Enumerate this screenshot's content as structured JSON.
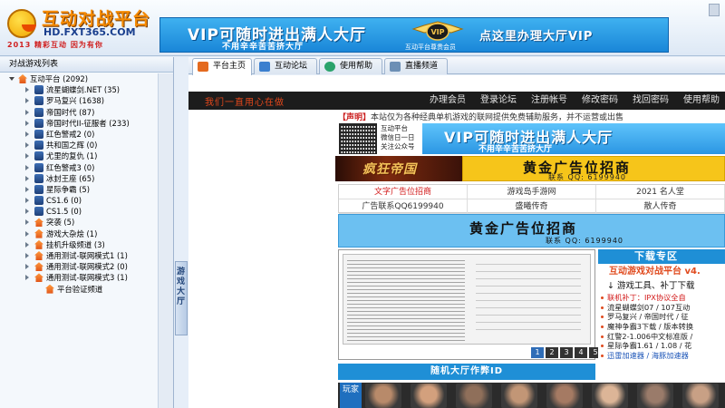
{
  "header": {
    "logo_title": "互动对战平台",
    "logo_domain": "HD.FXT365.COM",
    "logo_slogan": "2013 精彩互动 因为有你",
    "banner_main": "VIP可随时进出满人大厅",
    "banner_sub": "不用辛辛苦苦挤大厅",
    "banner_vip_caption": "互动平台尊贵会员",
    "banner_cta": "点这里办理大厅VIP"
  },
  "left_panel": {
    "title": "对战游戏列表",
    "tree": [
      {
        "label": "互动平台 (2092)",
        "level": 0,
        "expanded": true,
        "icon": "house-icon"
      },
      {
        "label": "流星蝴蝶剑.NET (35)",
        "level": 1,
        "icon": "game-icon"
      },
      {
        "label": "罗马复兴 (1638)",
        "level": 1,
        "icon": "game-icon"
      },
      {
        "label": "帝国时代 (87)",
        "level": 1,
        "icon": "game-icon"
      },
      {
        "label": "帝国时代II-征服者 (233)",
        "level": 1,
        "icon": "game-icon"
      },
      {
        "label": "红色警戒2 (0)",
        "level": 1,
        "icon": "game-icon"
      },
      {
        "label": "共和国之辉 (0)",
        "level": 1,
        "icon": "game-icon"
      },
      {
        "label": "尤里的复仇 (1)",
        "level": 1,
        "icon": "game-icon"
      },
      {
        "label": "红色警戒3 (0)",
        "level": 1,
        "icon": "game-icon"
      },
      {
        "label": "冰封王座 (65)",
        "level": 1,
        "icon": "game-icon"
      },
      {
        "label": "星际争霸 (5)",
        "level": 1,
        "icon": "game-icon"
      },
      {
        "label": "CS1.6 (0)",
        "level": 1,
        "icon": "game-icon"
      },
      {
        "label": "CS1.5 (0)",
        "level": 1,
        "icon": "game-icon"
      },
      {
        "label": "突袭 (5)",
        "level": 1,
        "icon": "house-icon"
      },
      {
        "label": "游戏大杂烩 (1)",
        "level": 1,
        "icon": "house-icon"
      },
      {
        "label": "挂机升级频道 (3)",
        "level": 1,
        "icon": "house-icon"
      },
      {
        "label": "通用测试-联网模式1 (1)",
        "level": 1,
        "icon": "house-icon"
      },
      {
        "label": "通用测试-联网模式2 (0)",
        "level": 1,
        "icon": "house-icon"
      },
      {
        "label": "通用测试-联网模式3 (1)",
        "level": 1,
        "icon": "house-icon"
      },
      {
        "label": "平台验证频道",
        "level": 2,
        "icon": "house-icon"
      }
    ],
    "collapse_tab": "游戏大厅"
  },
  "tabs": [
    {
      "label": "平台主页",
      "active": true,
      "icon": "home-icon"
    },
    {
      "label": "互动论坛",
      "active": false,
      "icon": "forum-icon"
    },
    {
      "label": "使用帮助",
      "active": false,
      "icon": "help-icon"
    },
    {
      "label": "直播频道",
      "active": false,
      "icon": "live-icon"
    }
  ],
  "navbar": {
    "slogan": "我们一直用心在做",
    "links": [
      "办理会员",
      "登录论坛",
      "注册帐号",
      "修改密码",
      "找回密码",
      "使用帮助"
    ]
  },
  "notice": {
    "tag": "【声明】",
    "text": "本站仅为各种经典单机游戏的联网提供免费辅助服务，并不运营或出售"
  },
  "qr": {
    "line1": "互动平台",
    "line2": "微信日一日",
    "line3": "关注公众号"
  },
  "vip_banner": {
    "main": "VIP可随时进出满人大厅",
    "sub": "不用辛辛苦苦挤大厅"
  },
  "game_ad": {
    "title": "疯狂帝国"
  },
  "gold_ad": {
    "title": "黄金广告位招商",
    "contact": "联系 QQ: 6199940"
  },
  "link_grid": [
    {
      "label": "文字广告位招商",
      "red": true
    },
    {
      "label": "游戏岛手游网",
      "red": false
    },
    {
      "label": "2021 名人堂",
      "red": false
    },
    {
      "label": "广告联系QQ6199940",
      "red": false
    },
    {
      "label": "盛曦传奇",
      "red": false
    },
    {
      "label": "散人传奇",
      "red": false
    }
  ],
  "gold_ad2": {
    "title": "黄金广告位招商",
    "contact": "联系 QQ: 6199940"
  },
  "video": {
    "pages": [
      "1",
      "2",
      "3",
      "4",
      "5"
    ],
    "active_page": "1",
    "caption": "随机大厅作弊ID"
  },
  "download": {
    "header": "下载专区",
    "title": "互动游戏对战平台 v4.",
    "subtitle": "↓ 游戏工具、补丁下载",
    "items": [
      {
        "text": "联机补丁：IPX协议全自",
        "style": "hl"
      },
      {
        "text": "流星蝴蝶剑07 / 107互动",
        "style": ""
      },
      {
        "text": "罗马复兴 / 帝国时代 / 征",
        "style": ""
      },
      {
        "text": "魔神争霸3下载 / 版本转换",
        "style": ""
      },
      {
        "text": "红警2-1.006中文标准版 / ",
        "style": ""
      },
      {
        "text": "星际争霸1.61 / 1.08 / 花",
        "style": ""
      },
      {
        "text": "迅雷加速器 / 海豚加速器",
        "style": "blue"
      }
    ]
  },
  "players": {
    "label": "玩家",
    "avatar_colors": [
      "#b88a6a",
      "#d3a07d",
      "#8f6f5a",
      "#c29676",
      "#a57a63",
      "#dcb597",
      "#9a7b6a",
      "#c8a085"
    ]
  },
  "colors": {
    "brand_orange": "#f58a00",
    "accent_blue": "#1f8fd6",
    "gold": "#f6c51a",
    "dark_nav": "#1c1c1c",
    "panel_bg": "#f4f8fc"
  }
}
